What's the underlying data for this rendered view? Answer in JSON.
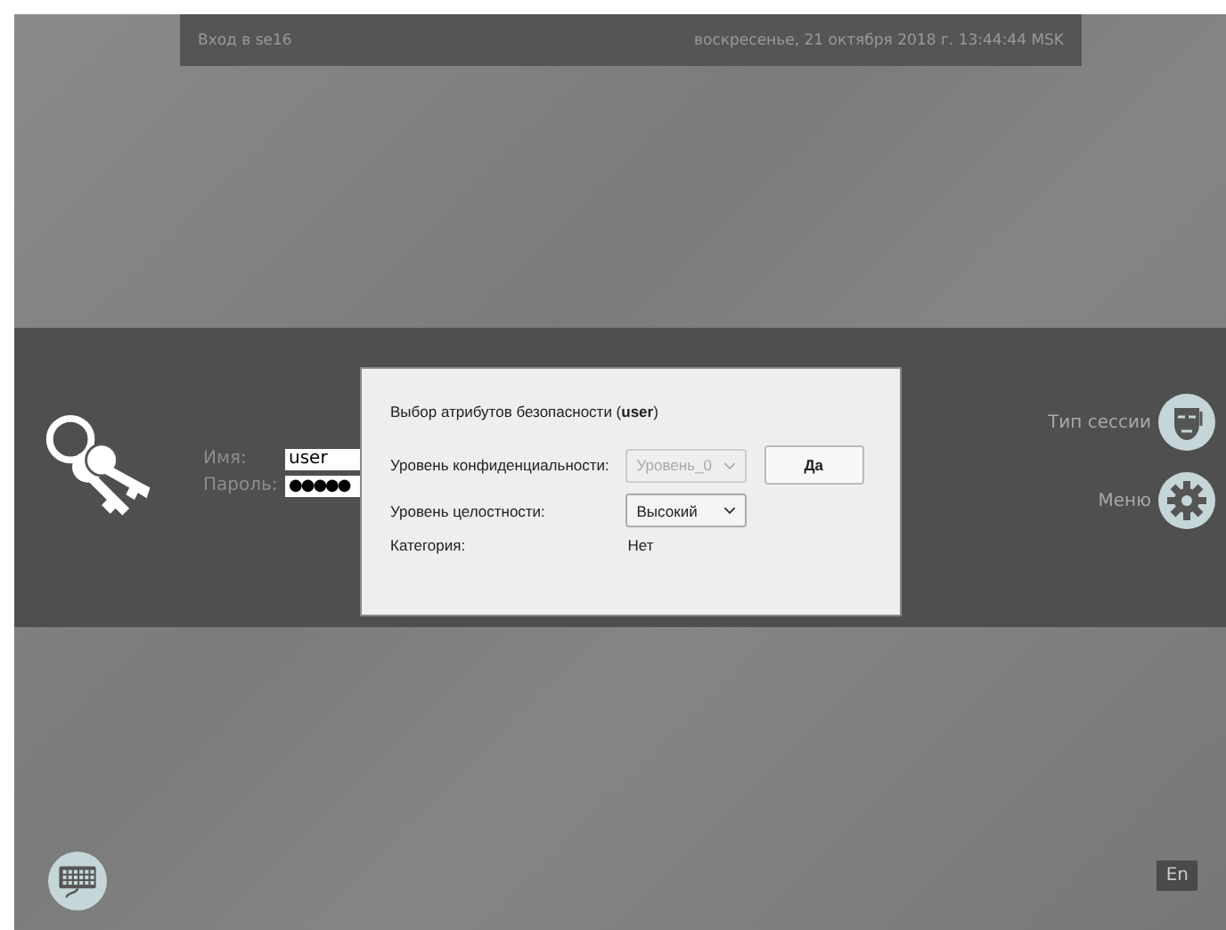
{
  "top_bar": {
    "host_label": "Вход в se16",
    "datetime": "воскресенье, 21 октября 2018 г. 13:44:44 MSK"
  },
  "login": {
    "fields": [
      {
        "label": "Имя:",
        "value": "user",
        "kind": "text"
      },
      {
        "label": "Пароль:",
        "value": "●●●●●",
        "kind": "password"
      }
    ]
  },
  "side_actions": [
    {
      "label": "Тип сессии",
      "kind": "mask"
    },
    {
      "label": "Меню",
      "kind": "gear"
    }
  ],
  "dialog": {
    "title": "Выбор атрибутов безопасности (**user**)",
    "rows": [
      {
        "label": "Уровень конфиденциальности:",
        "kind": "combo",
        "value": "Уровень_0",
        "disabled": true
      },
      {
        "label": "Уровень целостности:",
        "kind": "combo",
        "value": "Высокий",
        "disabled": false
      },
      {
        "label": "Категория:",
        "kind": "text",
        "value": "Нет"
      }
    ],
    "ok_button": "Да"
  },
  "bottom": {
    "language": "En"
  }
}
